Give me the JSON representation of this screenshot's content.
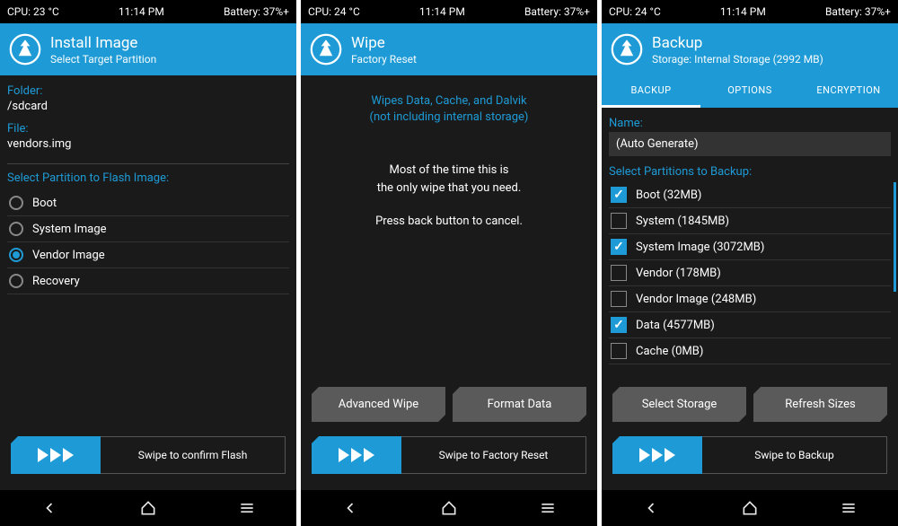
{
  "screens": [
    {
      "statusbar": {
        "cpu": "CPU: 23 °C",
        "time": "11:14 PM",
        "battery": "Battery: 37%+"
      },
      "header": {
        "title": "Install Image",
        "subtitle": "Select Target Partition"
      },
      "folder_label": "Folder:",
      "folder_value": "/sdcard",
      "file_label": "File:",
      "file_value": "vendors.img",
      "partition_label": "Select Partition to Flash Image:",
      "partitions": [
        "Boot",
        "System Image",
        "Vendor Image",
        "Recovery"
      ],
      "selected_partition": 2,
      "swipe_text": "Swipe to confirm Flash"
    },
    {
      "statusbar": {
        "cpu": "CPU: 24 °C",
        "time": "11:14 PM",
        "battery": "Battery: 37%+"
      },
      "header": {
        "title": "Wipe",
        "subtitle": "Factory Reset"
      },
      "info_line1": "Wipes Data, Cache, and Dalvik",
      "info_line2": "(not including internal storage)",
      "main_line1": "Most of the time this is",
      "main_line2": "the only wipe that you need.",
      "main_line3": "Press back button to cancel.",
      "btn1": "Advanced Wipe",
      "btn2": "Format Data",
      "swipe_text": "Swipe to Factory Reset"
    },
    {
      "statusbar": {
        "cpu": "CPU: 24 °C",
        "time": "11:14 PM",
        "battery": "Battery: 37%+"
      },
      "header": {
        "title": "Backup",
        "subtitle": "Storage: Internal Storage (2992 MB)"
      },
      "tabs": [
        "BACKUP",
        "OPTIONS",
        "ENCRYPTION"
      ],
      "active_tab": 0,
      "name_label": "Name:",
      "name_value": "(Auto Generate)",
      "partition_label": "Select Partitions to Backup:",
      "partitions": [
        {
          "label": "Boot (32MB)",
          "checked": true
        },
        {
          "label": "System (1845MB)",
          "checked": false
        },
        {
          "label": "System Image (3072MB)",
          "checked": true
        },
        {
          "label": "Vendor (178MB)",
          "checked": false
        },
        {
          "label": "Vendor Image (248MB)",
          "checked": false
        },
        {
          "label": "Data (4577MB)",
          "checked": true
        },
        {
          "label": "Cache (0MB)",
          "checked": false
        }
      ],
      "btn1": "Select Storage",
      "btn2": "Refresh Sizes",
      "swipe_text": "Swipe to Backup"
    }
  ]
}
